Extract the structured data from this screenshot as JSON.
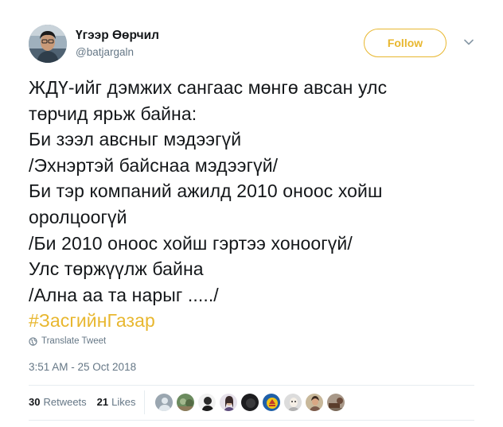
{
  "tweet": {
    "author": {
      "name": "Үгээр Өөрчил",
      "handle": "@batjargaln"
    },
    "follow_label": "Follow",
    "text_lines": [
      "ЖДҮ-ийг дэмжих сангаас мөнгө авсан улс",
      "төрчид ярьж байна:",
      "Би зээл авсныг мэдээгүй",
      "/Эхнэртэй байснаа мэдээгүй/",
      "Би тэр компаний ажилд 2010 оноос хойш",
      "оролцоогүй",
      "/Би 2010 оноос хойш гэртээ хоноогүй/",
      "Улс төржүүлж байна",
      "/Ална аа та нарыг ...../"
    ],
    "hashtag": "#ЗасгийнГазар",
    "translate_label": "Translate Tweet",
    "timestamp": "3:51 AM - 25 Oct 2018",
    "retweets": {
      "count": "30",
      "label": "Retweets"
    },
    "likes": {
      "count": "21",
      "label": "Likes"
    }
  },
  "colors": {
    "accent": "#e8b72f",
    "text": "#14171a",
    "muted": "#657786",
    "divider": "#e6ecf0"
  },
  "icons": {
    "caret": "chevron-down-icon",
    "translate": "globe-icon"
  },
  "liker_avatars": [
    {
      "name": "liker-avatar-1"
    },
    {
      "name": "liker-avatar-2"
    },
    {
      "name": "liker-avatar-3"
    },
    {
      "name": "liker-avatar-4"
    },
    {
      "name": "liker-avatar-5"
    },
    {
      "name": "liker-avatar-6"
    },
    {
      "name": "liker-avatar-7"
    },
    {
      "name": "liker-avatar-8"
    },
    {
      "name": "liker-avatar-9"
    }
  ]
}
